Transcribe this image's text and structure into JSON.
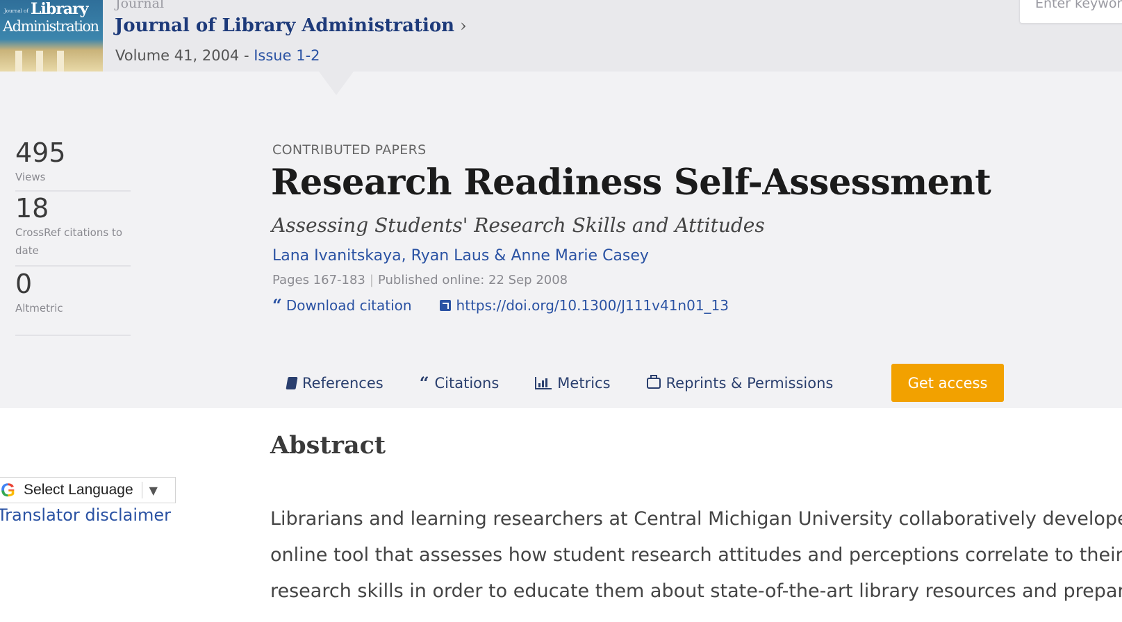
{
  "header": {
    "cover_small": "Journal of",
    "cover_line1": "Library",
    "cover_line2": "Administration",
    "journal_label": "Journal",
    "journal_title": "Journal of Library Administration",
    "volume": "Volume 41, 2004",
    "volume_sep": " - ",
    "issue": "Issue 1-2",
    "search_placeholder": "Enter keywords"
  },
  "metrics": [
    {
      "value": "495",
      "label": "Views"
    },
    {
      "value": "18",
      "label": "CrossRef citations to date"
    },
    {
      "value": "0",
      "label": "Altmetric"
    }
  ],
  "article": {
    "section": "CONTRIBUTED PAPERS",
    "title": "Research Readiness Self-Assessment",
    "subtitle": "Assessing Students' Research Skills and Attitudes",
    "authors": [
      "Lana Ivanitskaya",
      "Ryan Laus",
      "Anne Marie Casey"
    ],
    "author_sep1": ",",
    "author_sep2": "&",
    "pages": "Pages 167-183",
    "published": "Published online: 22 Sep 2008",
    "download_citation": "Download citation",
    "doi": "https://doi.org/10.1300/J111v41n01_13"
  },
  "tabs": {
    "references": "References",
    "citations": "Citations",
    "metrics": "Metrics",
    "reprints": "Reprints & Permissions",
    "get_access": "Get access"
  },
  "abstract": {
    "heading": "Abstract",
    "lines": [
      "Librarians and learning researchers at Central Michigan University collaboratively develope",
      "online tool that assesses how student research attitudes and perceptions correlate to their",
      "research skills in order to educate them about state-of-the-art library resources and prepar"
    ]
  },
  "translate": {
    "select_label": "Select Language",
    "disclaimer": "Translator disclaimer"
  },
  "colors": {
    "link": "#2a52a3",
    "accent_button": "#f2a100",
    "banner_bg": "#e9e9ec"
  }
}
